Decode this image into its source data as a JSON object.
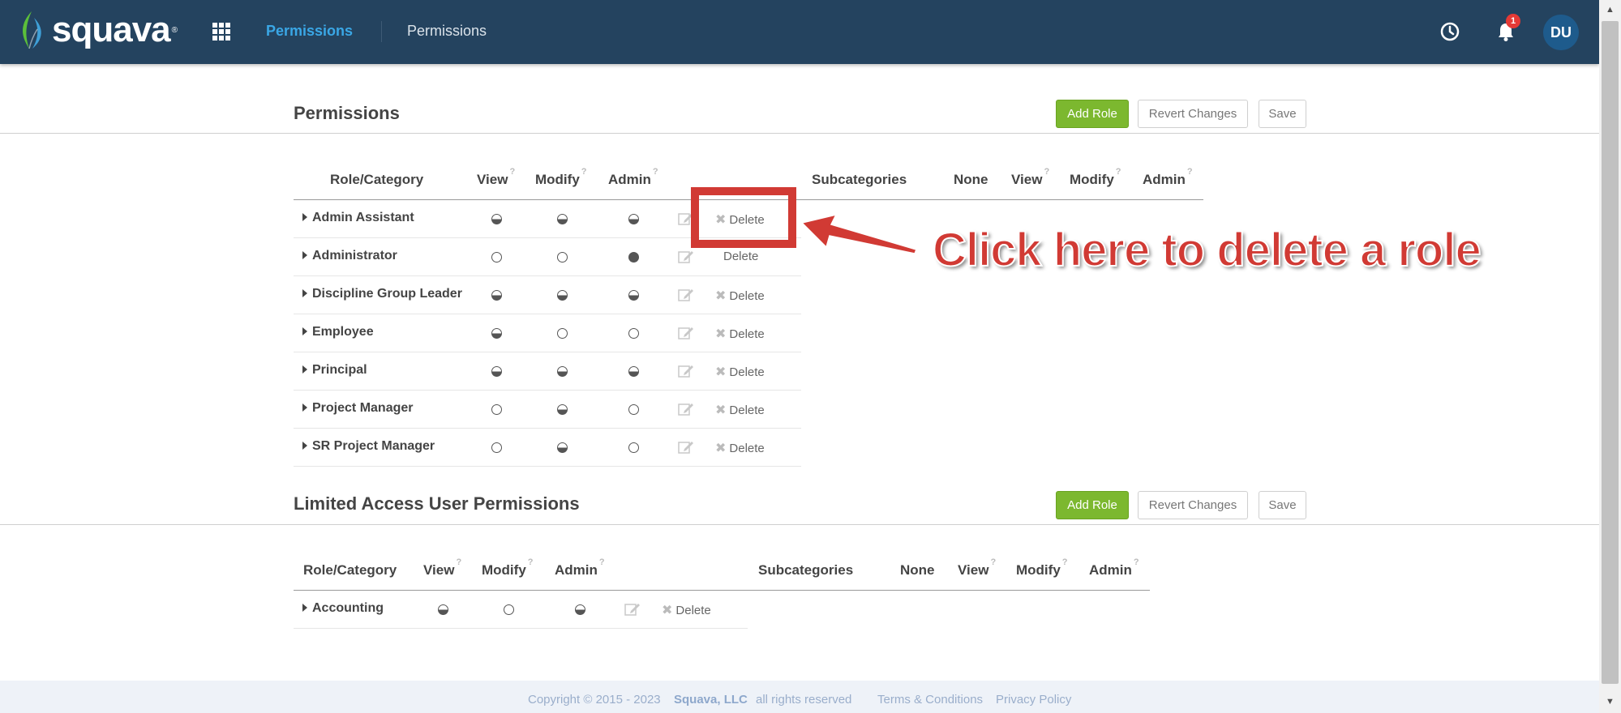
{
  "header": {
    "logo_text": "squava",
    "logo_reg": "®",
    "nav_active": "Permissions",
    "nav_second": "Permissions",
    "notification_count": "1",
    "avatar_initials": "DU"
  },
  "permissions": {
    "title": "Permissions",
    "add_role": "Add Role",
    "revert": "Revert Changes",
    "save": "Save",
    "columns": {
      "role_category": "Role/Category",
      "view": "View",
      "modify": "Modify",
      "admin": "Admin",
      "subcategories": "Subcategories",
      "none": "None",
      "sub_view": "View",
      "sub_modify": "Modify",
      "sub_admin": "Admin",
      "help": "?"
    },
    "roles": [
      {
        "name": "Admin Assistant",
        "view": "half",
        "modify": "half",
        "admin": "half",
        "delete": "Delete"
      },
      {
        "name": "Administrator",
        "view": "empty",
        "modify": "empty",
        "admin": "full",
        "delete": "Delete"
      },
      {
        "name": "Discipline Group Leader",
        "view": "half",
        "modify": "half",
        "admin": "half",
        "delete": "Delete"
      },
      {
        "name": "Employee",
        "view": "half",
        "modify": "empty",
        "admin": "empty",
        "delete": "Delete"
      },
      {
        "name": "Principal",
        "view": "half",
        "modify": "half",
        "admin": "half",
        "delete": "Delete"
      },
      {
        "name": "Project Manager",
        "view": "empty",
        "modify": "half",
        "admin": "empty",
        "delete": "Delete"
      },
      {
        "name": "SR Project Manager",
        "view": "empty",
        "modify": "half",
        "admin": "empty",
        "delete": "Delete"
      }
    ]
  },
  "limited": {
    "title": "Limited Access User Permissions",
    "add_role": "Add Role",
    "revert": "Revert Changes",
    "save": "Save",
    "columns": {
      "role_category": "Role/Category",
      "view": "View",
      "modify": "Modify",
      "admin": "Admin",
      "subcategories": "Subcategories",
      "none": "None",
      "sub_view": "View",
      "sub_modify": "Modify",
      "sub_admin": "Admin",
      "help": "?"
    },
    "roles": [
      {
        "name": "Accounting",
        "view": "half",
        "modify": "empty",
        "admin": "half",
        "delete": "Delete"
      }
    ]
  },
  "annotation": {
    "text": "Click here to delete a role",
    "color": "#d13a34"
  },
  "footer": {
    "copyright": "Copyright © 2015 - 2023",
    "company": "Squava, LLC",
    "rights": "all rights reserved",
    "terms": "Terms & Conditions",
    "privacy": "Privacy Policy"
  }
}
